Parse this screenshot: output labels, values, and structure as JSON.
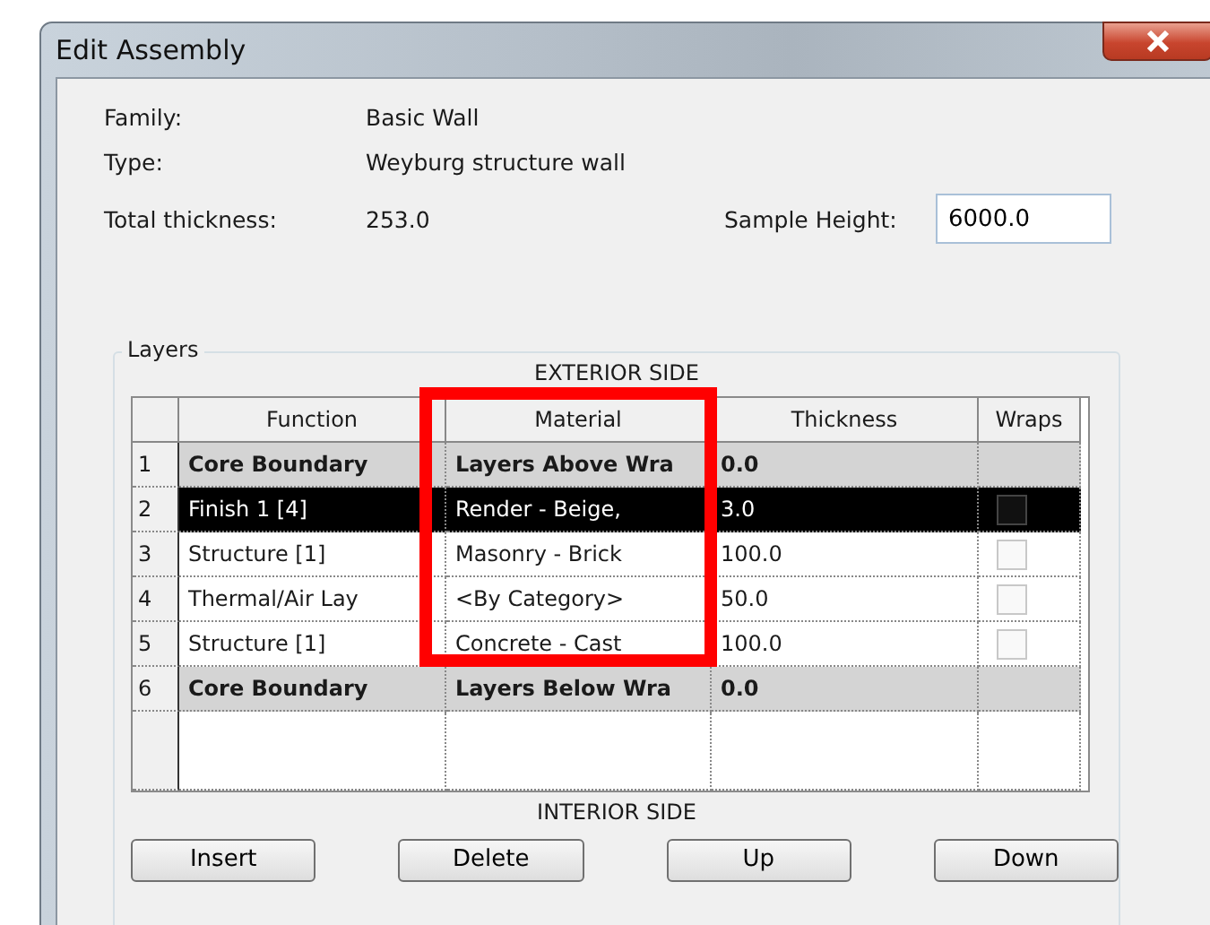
{
  "window": {
    "title": "Edit Assembly"
  },
  "info": [
    {
      "label": "Family:",
      "value": "Basic Wall"
    },
    {
      "label": "Type:",
      "value": "Weyburg structure wall"
    },
    {
      "label": "Total thickness:",
      "value": "253.0"
    }
  ],
  "sample_height": {
    "label": "Sample Height:",
    "value": "6000.0"
  },
  "layers": {
    "title": "Layers",
    "top_caption": "EXTERIOR SIDE",
    "bottom_caption": "INTERIOR SIDE",
    "columns": [
      "Function",
      "Material",
      "Thickness",
      "Wraps"
    ],
    "rows": [
      {
        "number": "1",
        "kind": "boundary",
        "selected": false,
        "function": "Core Boundary",
        "material": "Layers Above Wra",
        "thickness": "0.0"
      },
      {
        "number": "2",
        "kind": "layer",
        "selected": true,
        "function": "Finish 1 [4]",
        "material": "Render - Beige,",
        "thickness": "3.0",
        "wraps": false
      },
      {
        "number": "3",
        "kind": "layer",
        "selected": false,
        "function": "Structure [1]",
        "material": "Masonry - Brick",
        "thickness": "100.0",
        "wraps": false
      },
      {
        "number": "4",
        "kind": "layer",
        "selected": false,
        "function": "Thermal/Air Lay",
        "material": "<By Category>",
        "thickness": "50.0",
        "wraps": false
      },
      {
        "number": "5",
        "kind": "layer",
        "selected": false,
        "function": "Structure [1]",
        "material": "Concrete - Cast",
        "thickness": "100.0",
        "wraps": false
      },
      {
        "number": "6",
        "kind": "boundary",
        "selected": false,
        "function": "Core Boundary",
        "material": "Layers Below Wra",
        "thickness": "0.0"
      }
    ],
    "buttons": [
      "Insert",
      "Delete",
      "Up",
      "Down"
    ]
  }
}
